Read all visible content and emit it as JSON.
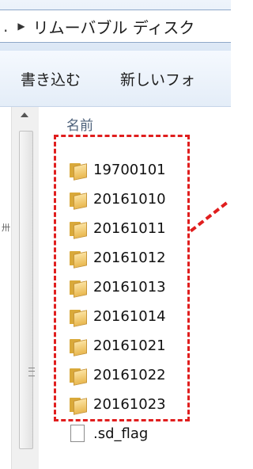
{
  "address_bar": {
    "prefix": ".",
    "arrow": "▶",
    "path": "リムーバブル ディスク"
  },
  "toolbar": {
    "burn_label": "書き込む",
    "new_folder_label": "新しいフォ"
  },
  "navigation_pane": {
    "mark": "卅"
  },
  "file_list": {
    "column_header": "名前",
    "items": [
      {
        "name": "19700101",
        "type": "folder"
      },
      {
        "name": "20161010",
        "type": "folder"
      },
      {
        "name": "20161011",
        "type": "folder"
      },
      {
        "name": "20161012",
        "type": "folder"
      },
      {
        "name": "20161013",
        "type": "folder"
      },
      {
        "name": "20161014",
        "type": "folder"
      },
      {
        "name": "20161021",
        "type": "folder"
      },
      {
        "name": "20161022",
        "type": "folder"
      },
      {
        "name": "20161023",
        "type": "folder"
      },
      {
        "name": ".sd_flag",
        "type": "file"
      }
    ]
  },
  "colors": {
    "highlight": "#e01e1e",
    "folder": "#e9b84f"
  }
}
